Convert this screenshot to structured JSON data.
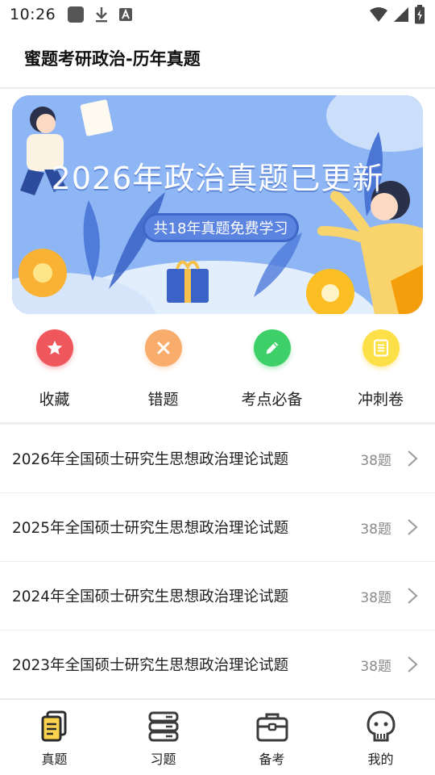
{
  "status_bar": {
    "time": "10:26",
    "left_icons": [
      "app-square-icon",
      "download-icon",
      "font-a-icon"
    ],
    "right_icons": [
      "wifi-icon",
      "signal-icon",
      "battery-icon"
    ]
  },
  "header": {
    "title": "蜜题考研政治-历年真题"
  },
  "banner": {
    "headline": "2026年政治真题已更新",
    "subline": "共18年真题免费学习",
    "background": "#8eb6f4"
  },
  "quick_menu": [
    {
      "label": "收藏",
      "icon": "star-icon",
      "color": "#f0575d"
    },
    {
      "label": "错题",
      "icon": "close-icon",
      "color": "#f8ad6d"
    },
    {
      "label": "考点必备",
      "icon": "pencil-icon",
      "color": "#3ed068"
    },
    {
      "label": "冲刺卷",
      "icon": "document-icon",
      "color": "#fde047"
    }
  ],
  "papers": [
    {
      "title": "2026年全国硕士研究生思想政治理论试题",
      "count": "38题"
    },
    {
      "title": "2025年全国硕士研究生思想政治理论试题",
      "count": "38题"
    },
    {
      "title": "2024年全国硕士研究生思想政治理论试题",
      "count": "38题"
    },
    {
      "title": "2023年全国硕士研究生思想政治理论试题",
      "count": "38题"
    }
  ],
  "bottom_nav": [
    {
      "label": "真题",
      "icon": "papers-icon",
      "active": true
    },
    {
      "label": "习题",
      "icon": "stack-icon",
      "active": false
    },
    {
      "label": "备考",
      "icon": "briefcase-icon",
      "active": false
    },
    {
      "label": "我的",
      "icon": "profile-icon",
      "active": false
    }
  ],
  "colors": {
    "accent_yellow": "#fcd34d",
    "divider": "#ececec"
  }
}
